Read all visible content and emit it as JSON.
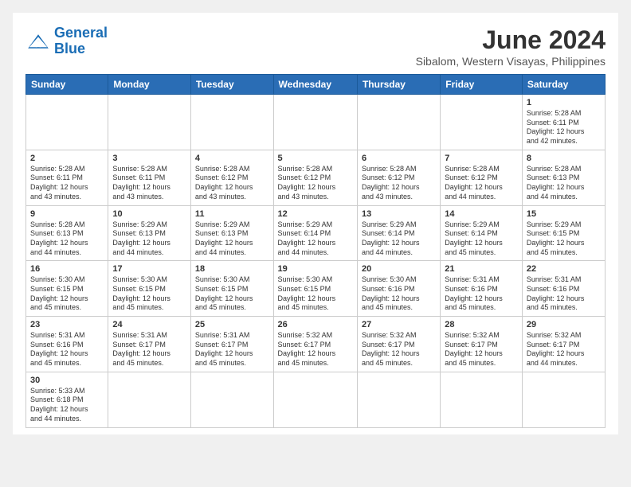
{
  "header": {
    "logo_general": "General",
    "logo_blue": "Blue",
    "month_title": "June 2024",
    "location": "Sibalom, Western Visayas, Philippines"
  },
  "days_of_week": [
    "Sunday",
    "Monday",
    "Tuesday",
    "Wednesday",
    "Thursday",
    "Friday",
    "Saturday"
  ],
  "weeks": [
    [
      {
        "day": "",
        "info": ""
      },
      {
        "day": "",
        "info": ""
      },
      {
        "day": "",
        "info": ""
      },
      {
        "day": "",
        "info": ""
      },
      {
        "day": "",
        "info": ""
      },
      {
        "day": "",
        "info": ""
      },
      {
        "day": "1",
        "info": "Sunrise: 5:28 AM\nSunset: 6:11 PM\nDaylight: 12 hours\nand 42 minutes."
      }
    ],
    [
      {
        "day": "2",
        "info": "Sunrise: 5:28 AM\nSunset: 6:11 PM\nDaylight: 12 hours\nand 43 minutes."
      },
      {
        "day": "3",
        "info": "Sunrise: 5:28 AM\nSunset: 6:11 PM\nDaylight: 12 hours\nand 43 minutes."
      },
      {
        "day": "4",
        "info": "Sunrise: 5:28 AM\nSunset: 6:12 PM\nDaylight: 12 hours\nand 43 minutes."
      },
      {
        "day": "5",
        "info": "Sunrise: 5:28 AM\nSunset: 6:12 PM\nDaylight: 12 hours\nand 43 minutes."
      },
      {
        "day": "6",
        "info": "Sunrise: 5:28 AM\nSunset: 6:12 PM\nDaylight: 12 hours\nand 43 minutes."
      },
      {
        "day": "7",
        "info": "Sunrise: 5:28 AM\nSunset: 6:12 PM\nDaylight: 12 hours\nand 44 minutes."
      },
      {
        "day": "8",
        "info": "Sunrise: 5:28 AM\nSunset: 6:13 PM\nDaylight: 12 hours\nand 44 minutes."
      }
    ],
    [
      {
        "day": "9",
        "info": "Sunrise: 5:28 AM\nSunset: 6:13 PM\nDaylight: 12 hours\nand 44 minutes."
      },
      {
        "day": "10",
        "info": "Sunrise: 5:29 AM\nSunset: 6:13 PM\nDaylight: 12 hours\nand 44 minutes."
      },
      {
        "day": "11",
        "info": "Sunrise: 5:29 AM\nSunset: 6:13 PM\nDaylight: 12 hours\nand 44 minutes."
      },
      {
        "day": "12",
        "info": "Sunrise: 5:29 AM\nSunset: 6:14 PM\nDaylight: 12 hours\nand 44 minutes."
      },
      {
        "day": "13",
        "info": "Sunrise: 5:29 AM\nSunset: 6:14 PM\nDaylight: 12 hours\nand 44 minutes."
      },
      {
        "day": "14",
        "info": "Sunrise: 5:29 AM\nSunset: 6:14 PM\nDaylight: 12 hours\nand 45 minutes."
      },
      {
        "day": "15",
        "info": "Sunrise: 5:29 AM\nSunset: 6:15 PM\nDaylight: 12 hours\nand 45 minutes."
      }
    ],
    [
      {
        "day": "16",
        "info": "Sunrise: 5:30 AM\nSunset: 6:15 PM\nDaylight: 12 hours\nand 45 minutes."
      },
      {
        "day": "17",
        "info": "Sunrise: 5:30 AM\nSunset: 6:15 PM\nDaylight: 12 hours\nand 45 minutes."
      },
      {
        "day": "18",
        "info": "Sunrise: 5:30 AM\nSunset: 6:15 PM\nDaylight: 12 hours\nand 45 minutes."
      },
      {
        "day": "19",
        "info": "Sunrise: 5:30 AM\nSunset: 6:15 PM\nDaylight: 12 hours\nand 45 minutes."
      },
      {
        "day": "20",
        "info": "Sunrise: 5:30 AM\nSunset: 6:16 PM\nDaylight: 12 hours\nand 45 minutes."
      },
      {
        "day": "21",
        "info": "Sunrise: 5:31 AM\nSunset: 6:16 PM\nDaylight: 12 hours\nand 45 minutes."
      },
      {
        "day": "22",
        "info": "Sunrise: 5:31 AM\nSunset: 6:16 PM\nDaylight: 12 hours\nand 45 minutes."
      }
    ],
    [
      {
        "day": "23",
        "info": "Sunrise: 5:31 AM\nSunset: 6:16 PM\nDaylight: 12 hours\nand 45 minutes."
      },
      {
        "day": "24",
        "info": "Sunrise: 5:31 AM\nSunset: 6:17 PM\nDaylight: 12 hours\nand 45 minutes."
      },
      {
        "day": "25",
        "info": "Sunrise: 5:31 AM\nSunset: 6:17 PM\nDaylight: 12 hours\nand 45 minutes."
      },
      {
        "day": "26",
        "info": "Sunrise: 5:32 AM\nSunset: 6:17 PM\nDaylight: 12 hours\nand 45 minutes."
      },
      {
        "day": "27",
        "info": "Sunrise: 5:32 AM\nSunset: 6:17 PM\nDaylight: 12 hours\nand 45 minutes."
      },
      {
        "day": "28",
        "info": "Sunrise: 5:32 AM\nSunset: 6:17 PM\nDaylight: 12 hours\nand 45 minutes."
      },
      {
        "day": "29",
        "info": "Sunrise: 5:32 AM\nSunset: 6:17 PM\nDaylight: 12 hours\nand 44 minutes."
      }
    ],
    [
      {
        "day": "30",
        "info": "Sunrise: 5:33 AM\nSunset: 6:18 PM\nDaylight: 12 hours\nand 44 minutes."
      },
      {
        "day": "",
        "info": ""
      },
      {
        "day": "",
        "info": ""
      },
      {
        "day": "",
        "info": ""
      },
      {
        "day": "",
        "info": ""
      },
      {
        "day": "",
        "info": ""
      },
      {
        "day": "",
        "info": ""
      }
    ]
  ]
}
